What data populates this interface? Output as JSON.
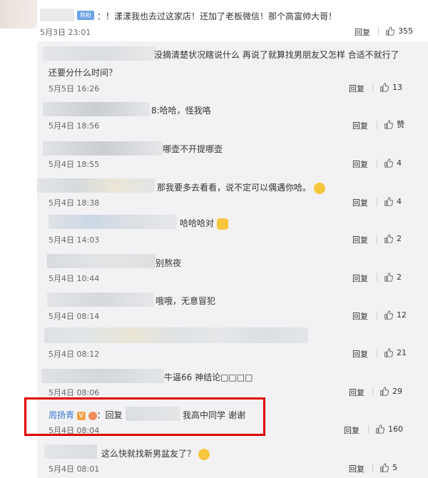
{
  "top_comment": {
    "badge": "铁粉",
    "text": "：！漾漾我也去过这家店！还加了老板微信！那个高富帅大哥！",
    "time": "5月3日 23:01",
    "reply_label": "回复",
    "likes": "355"
  },
  "replies": [
    {
      "text_line1": "没摘清楚状况瞎说什么 再说了就算找男朋友又怎样 合适不就行了",
      "text_line2": "还要分什么时间？",
      "time": "5月5日 16:26",
      "reply_label": "回复",
      "likes": "13"
    },
    {
      "text_line1": "8:哈哈，怪我咯",
      "time": "5月4日 18:56",
      "reply_label": "回复",
      "likes": "赞"
    },
    {
      "text_line1": "哪壶不开提哪壶",
      "time": "5月4日 18:55",
      "reply_label": "回复",
      "likes": "4"
    },
    {
      "text_line1": "那我要多去看看，说不定可以偶遇你哈。",
      "time": "5月4日 18:38",
      "reply_label": "回复",
      "likes": "4"
    },
    {
      "text_line1": "哈哈哈对",
      "time": "5月4日 14:03",
      "reply_label": "回复",
      "likes": "2"
    },
    {
      "text_line1": "别熬夜",
      "time": "5月4日 10:44",
      "reply_label": "回复",
      "likes": "2"
    },
    {
      "text_line1": "哦哦，无意冒犯",
      "time": "5月4日 08:14",
      "reply_label": "回复",
      "likes": "12"
    },
    {
      "text_line1": "",
      "time": "5月4日 08:12",
      "reply_label": "回复",
      "likes": "21"
    },
    {
      "text_line1": "牛逼66 神结论□□□□",
      "time": "5月4日 08:06",
      "reply_label": "回复",
      "likes": "29"
    },
    {
      "author": "周扬青",
      "prefix": "：回复",
      "text_line1": "我高中同学 谢谢",
      "time": "5月4日 08:04",
      "reply_label": "回复",
      "likes": "160"
    },
    {
      "text_line1": "这么快就找新男盆友了？",
      "time": "5月4日 08:01",
      "reply_label": "回复",
      "likes": "5"
    }
  ]
}
